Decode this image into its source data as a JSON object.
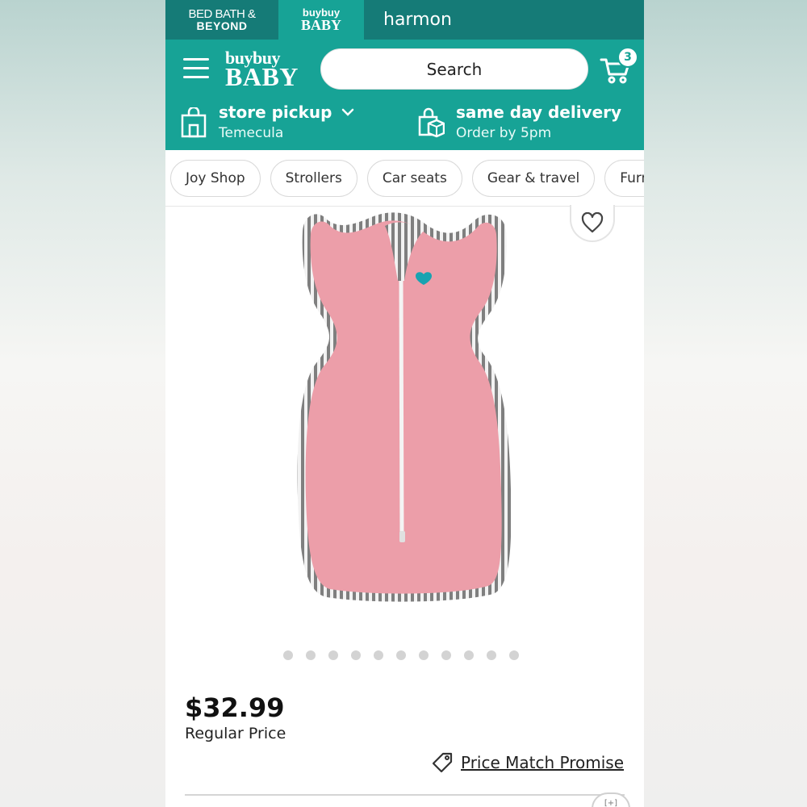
{
  "brand_bar": {
    "bbb_line1": "BED BATH &",
    "bbb_line2": "BEYOND",
    "bbaby_line1": "buybuy",
    "bbaby_line2": "BABY",
    "user": "harmon"
  },
  "header": {
    "logo_line1": "buybuy",
    "logo_line2": "BABY",
    "search_placeholder": "Search",
    "cart_count": "3",
    "pickup_title": "store pickup",
    "pickup_store": "Temecula",
    "delivery_title": "same day delivery",
    "delivery_sub": "Order by 5pm"
  },
  "categories": [
    "Joy Shop",
    "Strollers",
    "Car seats",
    "Gear & travel",
    "Furni"
  ],
  "product": {
    "carousel_count": 11,
    "price": "$32.99",
    "price_label": "Regular Price",
    "price_match": "Price Match Promise",
    "peek_text": "[+]"
  },
  "colors": {
    "brand_dark": "#157b77",
    "brand": "#17a396",
    "swaddle_pink": "#ec9ea9"
  }
}
